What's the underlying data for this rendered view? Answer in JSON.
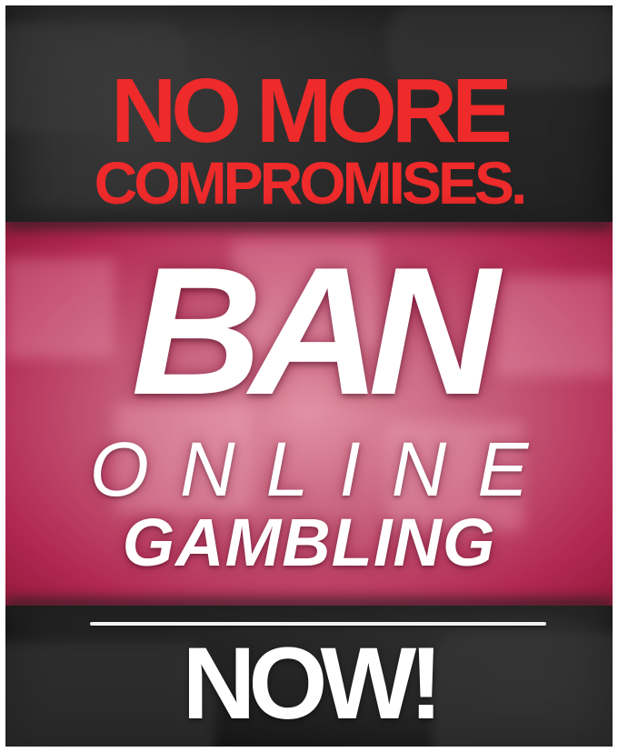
{
  "poster": {
    "headline_line1": "NO MORE",
    "headline_line2": "COMPROMISES.",
    "main_word": "BAN",
    "sub_line1": "ONLINE",
    "sub_line2": "GAMBLING",
    "call_to_action": "NOW!"
  },
  "colors": {
    "headline": "#ee2a2a",
    "main_text": "#ffffff",
    "band_accent": "#d45a82",
    "background": "#232323"
  }
}
